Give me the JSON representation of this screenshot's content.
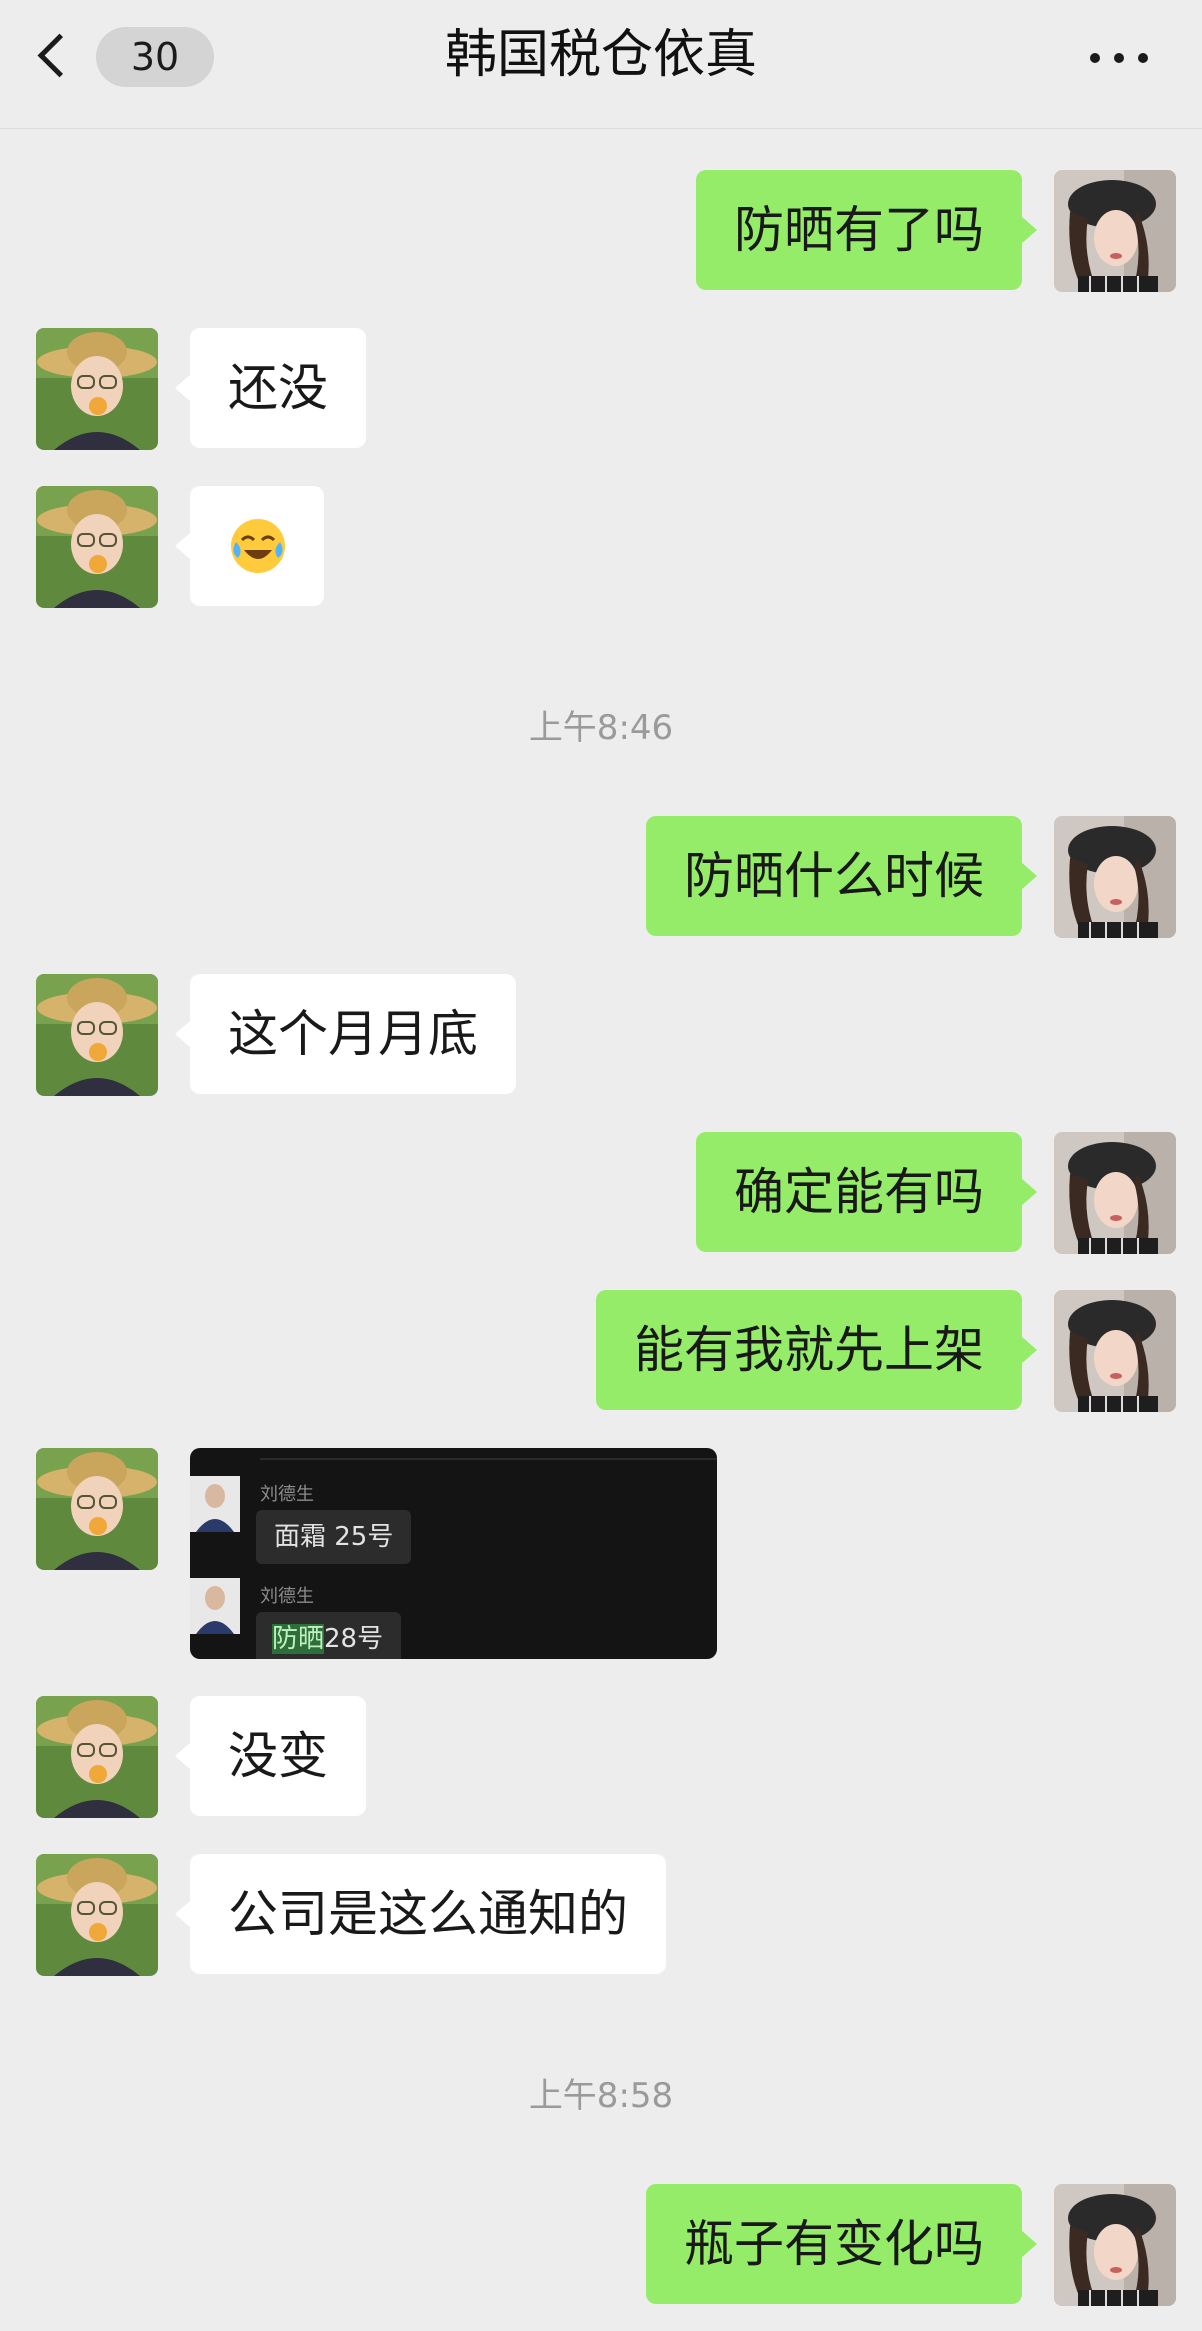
{
  "header": {
    "unread_count": "30",
    "title": "韩国税仓依真"
  },
  "messages": [
    {
      "id": "m1",
      "side": "out",
      "text": "防晒有了吗"
    },
    {
      "id": "m2",
      "side": "in",
      "text": "还没"
    },
    {
      "id": "m3",
      "side": "in",
      "emoji": "crying-laughing-emoji"
    },
    {
      "id": "t1",
      "time": "上午8:46"
    },
    {
      "id": "m4",
      "side": "out",
      "text": "防晒什么时候"
    },
    {
      "id": "m5",
      "side": "in",
      "text": "这个月月底"
    },
    {
      "id": "m6",
      "side": "out",
      "text": "确定能有吗"
    },
    {
      "id": "m7",
      "side": "out",
      "text": "能有我就先上架"
    },
    {
      "id": "m8",
      "side": "in",
      "image": {
        "rows": [
          {
            "sender": "刘德生",
            "text": "面霜 25号"
          },
          {
            "sender": "刘德生",
            "highlight": "防晒",
            "text": "28号"
          }
        ]
      }
    },
    {
      "id": "m9",
      "side": "in",
      "text": "没变"
    },
    {
      "id": "m10",
      "side": "in",
      "text": "公司是这么通知的"
    },
    {
      "id": "t2",
      "time": "上午8:58"
    },
    {
      "id": "m11",
      "side": "out",
      "text": "瓶子有变化吗"
    }
  ],
  "colors": {
    "background": "#ededed",
    "outgoing_bubble": "#95ec69",
    "incoming_bubble": "#ffffff",
    "timestamp": "#9a9a9a"
  }
}
